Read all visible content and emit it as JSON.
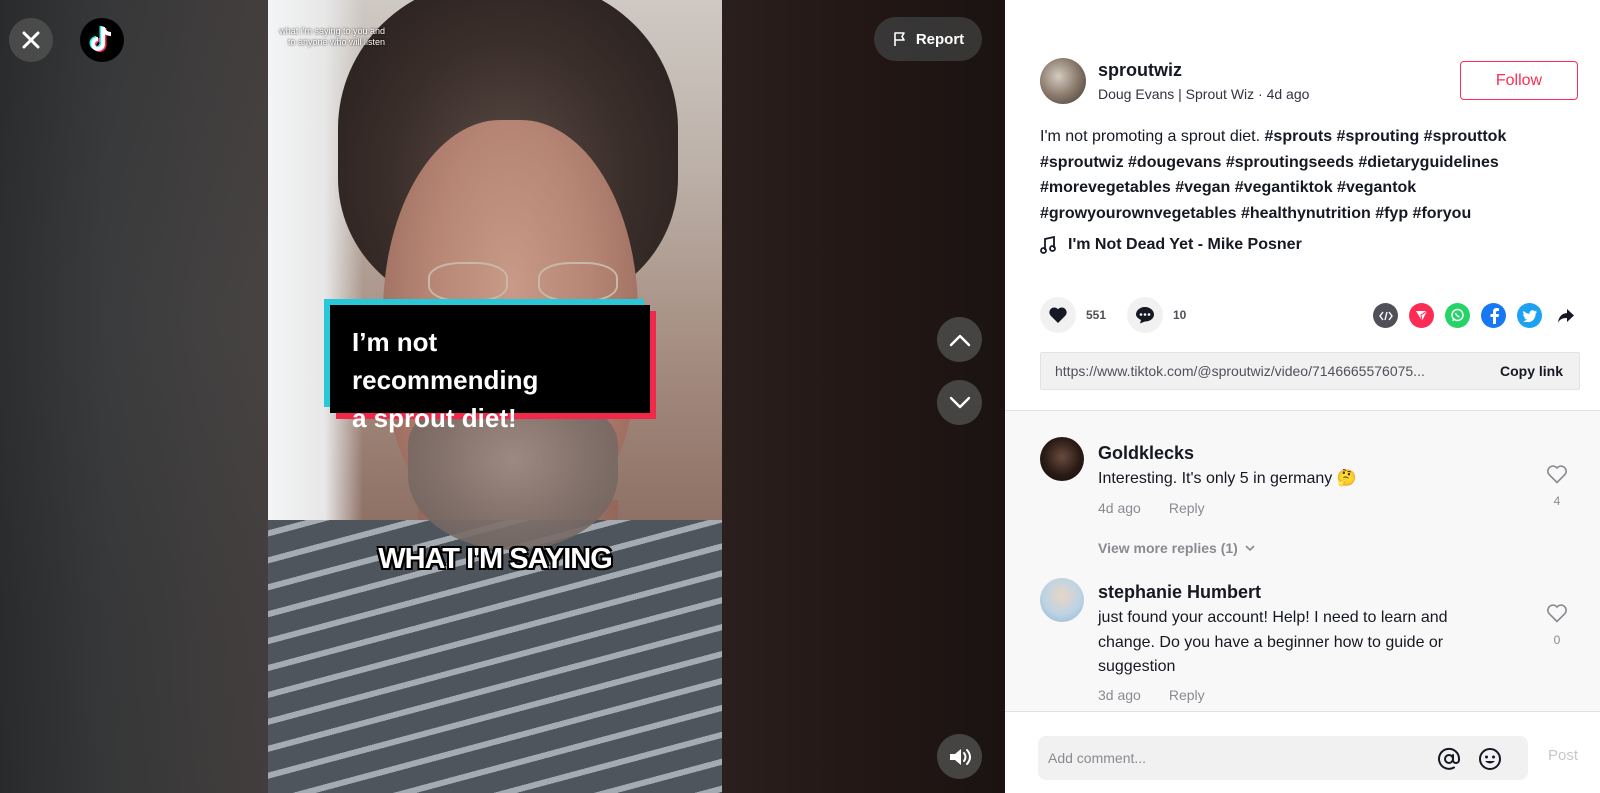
{
  "video": {
    "small_caption": "what i'm saying to you and to anyone who will listen",
    "overlay_line1": "I’m not recommending",
    "overlay_line2": "a sprout diet!",
    "caption": "WHAT I'M SAYING",
    "report_label": "Report"
  },
  "author": {
    "username": "sproutwiz",
    "subtitle": "Doug Evans | Sprout Wiz · 4d ago",
    "follow_label": "Follow"
  },
  "description": {
    "text": "I'm not promoting a sprout diet.",
    "hashtags": [
      "#sprouts",
      "#sprouting",
      "#sprouttok",
      "#sproutwiz",
      "#dougevans",
      "#sproutingseeds",
      "#dietaryguidelines",
      "#morevegetables",
      "#vegan",
      "#vegantiktok",
      "#vegantok",
      "#growyourownvegetables",
      "#healthynutrition",
      "#fyp",
      "#foryou"
    ]
  },
  "music": {
    "title": "I'm Not Dead Yet - Mike Posner"
  },
  "stats": {
    "likes": "551",
    "comments": "10"
  },
  "share_icons": [
    "embed-icon",
    "send-icon",
    "whatsapp-icon",
    "facebook-icon",
    "twitter-icon",
    "share-arrow-icon"
  ],
  "link": {
    "url": "https://www.tiktok.com/@sproutwiz/video/7146665576075...",
    "copy_label": "Copy link"
  },
  "comments": [
    {
      "user": "Goldklecks",
      "text": "Interesting. It's only 5 in germany 🤔",
      "time": "4d ago",
      "reply_label": "Reply",
      "likes": "4",
      "more_replies": "View more replies (1)"
    },
    {
      "user": "stephanie Humbert",
      "text": "just found your account! Help! I need to learn and change. Do you have a beginner how to guide or suggestion",
      "time": "3d ago",
      "reply_label": "Reply",
      "likes": "0"
    }
  ],
  "comment_bar": {
    "placeholder": "Add comment...",
    "post_label": "Post"
  },
  "colors": {
    "accent": "#fe2c55",
    "cyan": "#25f4ee"
  }
}
